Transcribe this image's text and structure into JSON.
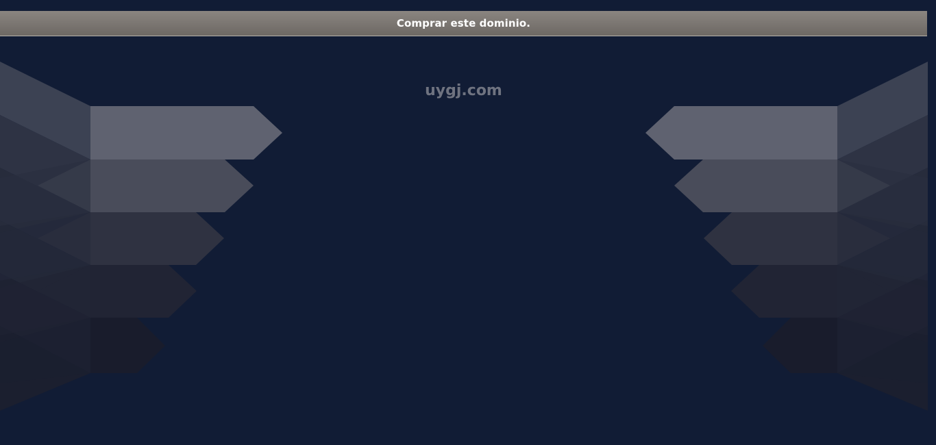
{
  "banner": {
    "buy_label": "Comprar este dominio."
  },
  "domain": {
    "name": "uygj.com"
  },
  "colors": {
    "background": "#111c35",
    "banner_top": "#8a8580",
    "banner_bottom": "#6d6864",
    "domain_text": "#6f7380"
  }
}
